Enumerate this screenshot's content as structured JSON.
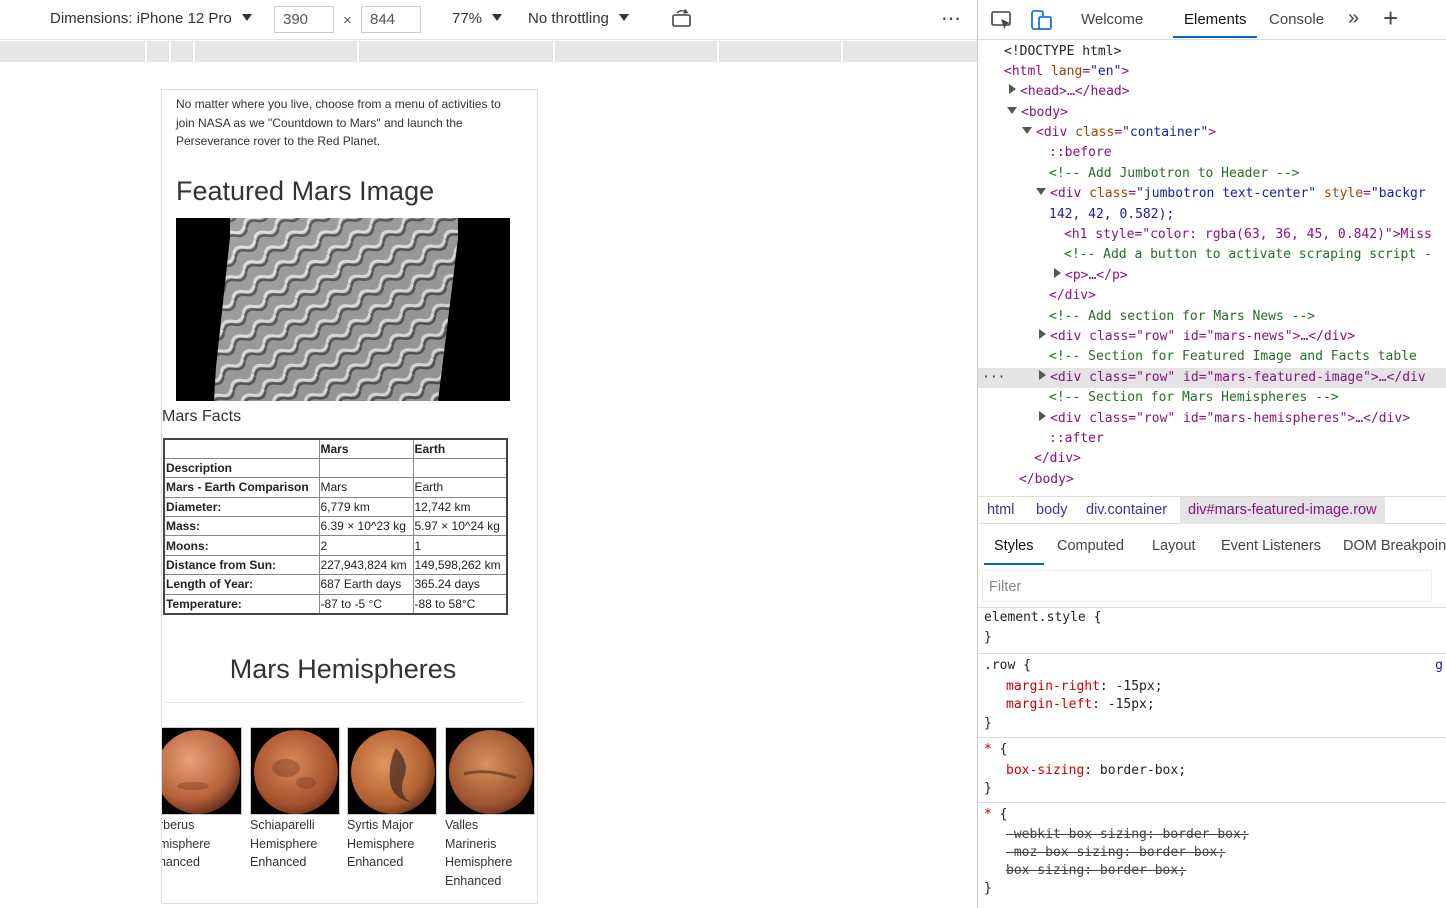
{
  "toolbar": {
    "dimensions_label": "Dimensions: iPhone 12 Pro",
    "width_value": "390",
    "times_symbol": "×",
    "height_value": "844",
    "zoom_label": "77%",
    "throttle_label": "No throttling",
    "more_label": "⋯"
  },
  "page": {
    "intro_text": "No matter where you live, choose from a menu of activities to join NASA as we \"Countdown to Mars\" and launch the Perseverance rover to the Red Planet.",
    "featured_title": "Featured Mars Image",
    "facts_title": "Mars Facts",
    "facts_headers": [
      "",
      "Mars",
      "Earth"
    ],
    "facts_rows": [
      [
        "Description",
        "",
        ""
      ],
      [
        "Mars - Earth Comparison",
        "Mars",
        "Earth"
      ],
      [
        "Diameter:",
        "6,779 km",
        "12,742 km"
      ],
      [
        "Mass:",
        "6.39 × 10^23 kg",
        "5.97 × 10^24 kg"
      ],
      [
        "Moons:",
        "2",
        "1"
      ],
      [
        "Distance from Sun:",
        "227,943,824 km",
        "149,598,262 km"
      ],
      [
        "Length of Year:",
        "687 Earth days",
        "365.24 days"
      ],
      [
        "Temperature:",
        "-87 to -5 °C",
        "-88 to 58°C"
      ]
    ],
    "hemispheres_title": "Mars Hemispheres",
    "hemispheres": [
      {
        "lines": [
          "erberus",
          "emisphere",
          "nhanced"
        ]
      },
      {
        "lines": [
          "Schiaparelli",
          "Hemisphere",
          "Enhanced"
        ]
      },
      {
        "lines": [
          "Syrtis Major",
          "Hemisphere",
          "Enhanced"
        ]
      },
      {
        "lines": [
          "Valles",
          "Marineris",
          "Hemisphere",
          "Enhanced"
        ]
      }
    ]
  },
  "devtools": {
    "tabs": [
      "Welcome",
      "Elements",
      "Console"
    ],
    "active_tab": "Elements",
    "dom": {
      "doctype": "<!DOCTYPE html>",
      "html_open": "<html",
      "lang_attr": "lang",
      "lang_val": "\"en\"",
      "head": "<head>…</head>",
      "body_open": "<body>",
      "container_open": "<div",
      "class_attr": "class",
      "container_val": "\"container\"",
      "before": "::before",
      "c_jumbo": "<!-- Add Jumbotron to Header -->",
      "jumbo_val": "\"jumbotron text-center\"",
      "style_attr": "style",
      "style_val": "\"backgr",
      "style_cont": "142, 42, 0.582);",
      "h1_text": "<h1 style=\"color: rgba(63, 36, 45, 0.842)\">Miss",
      "c_button": "<!-- Add a button to activate scraping script -",
      "p_collapsed": "<p>…</p>",
      "div_close": "</div>",
      "c_news": "<!-- Add section for Mars News -->",
      "news_line": "<div class=\"row\" id=\"mars-news\">…</div>",
      "c_featured": "<!-- Section for Featured Image and Facts table",
      "featured_line": "<div class=\"row\" id=\"mars-featured-image\">…</div",
      "c_hemi": "<!-- Section for Mars Hemispheres -->",
      "hemi_line": "<div class=\"row\" id=\"mars-hemispheres\">…</div>",
      "after": "::after",
      "body_close": "</body>",
      "dots": "···"
    },
    "breadcrumbs": [
      "html",
      "body",
      "div.container",
      "div#mars-featured-image.row"
    ],
    "style_tabs": [
      "Styles",
      "Computed",
      "Layout",
      "Event Listeners",
      "DOM Breakpoin"
    ],
    "filter_placeholder": "Filter",
    "rules": {
      "element_style": "element.style {",
      "close": "}",
      "row_sel": ".row {",
      "row_src": "g",
      "mr_name": "margin-right",
      "mr_val": ": -15px;",
      "ml_name": "margin-left",
      "ml_val": ": -15px;",
      "star_sel": "* {",
      "bs_name": "box-sizing",
      "bs_val": ": border-box;",
      "wk_name": "-webkit-box-sizing",
      "wk_val": ": border-box;",
      "moz_name": "-moz-box-sizing",
      "moz_val": ": border-box;",
      "bs2_name": "box-sizing",
      "bs2_val": ": border-box;"
    }
  }
}
